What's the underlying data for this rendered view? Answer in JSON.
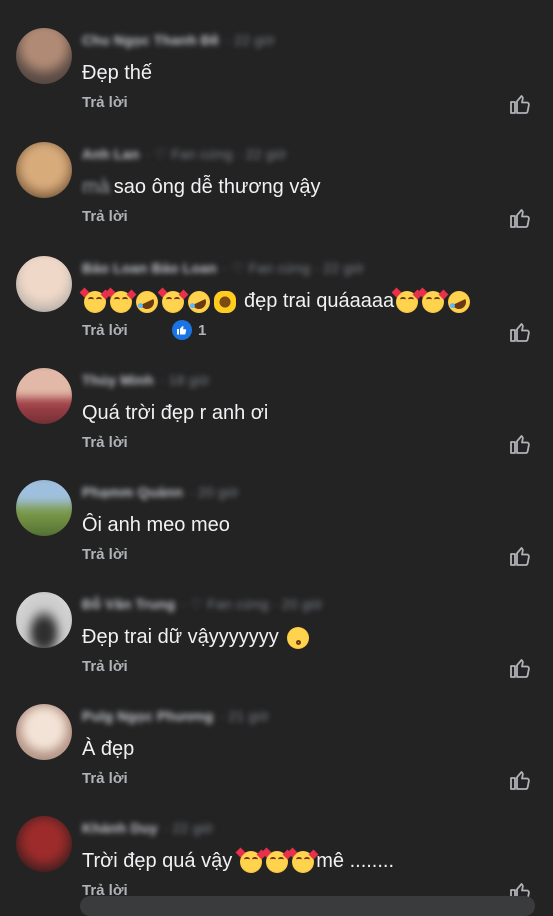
{
  "comments": [
    {
      "author": "Chu Ngọc Thanh Đề",
      "meta": "· 22 giờ",
      "text": "Đẹp thế",
      "reply": "Trả lời",
      "avatar": [
        "#5b4b45",
        "#b08a74"
      ]
    },
    {
      "author": "Anh Lan",
      "meta": "· ♡ Fan cứng · 22 giờ",
      "mention": "mà",
      "text": "sao ông dễ thương vậy",
      "reply": "Trả lời",
      "avatar": [
        "#7a5a3a",
        "#d8ab7b"
      ]
    },
    {
      "author": "Bảo Loan Bảo Loan",
      "meta": "· ♡ Fan cứng · 22 giờ",
      "text": "đẹp trai quáaaaa",
      "reply": "Trả lời",
      "reactions": "1",
      "avatar": [
        "#b9b1aa",
        "#f0d8c8"
      ]
    },
    {
      "author": "Thúy Minh",
      "meta": "· 18 giờ",
      "text": "Quá trời đẹp r anh ơi",
      "reply": "Trả lời",
      "avatar": [
        "#a4434a",
        "#e2b9a8"
      ]
    },
    {
      "author": "Phạmm Quảnn",
      "meta": "· 20 giờ",
      "text": "Ôi anh meo meo",
      "reply": "Trả lời",
      "avatar": [
        "#7aa0c0",
        "#4d6b2f"
      ]
    },
    {
      "author": "Đỗ Văn Trung",
      "meta": "· ♡ Fan cứng · 20 giờ",
      "text": "Đẹp trai dữ vậyyyyyyy",
      "reply": "Trả lời",
      "avatar": [
        "#c9c9c9",
        "#2f2f2f"
      ]
    },
    {
      "author": "Pulg Ngọc Phương",
      "meta": "· 21 giờ",
      "text": "À đẹp",
      "reply": "Trả lời",
      "avatar": [
        "#e6d5c9",
        "#b08f80"
      ]
    },
    {
      "author": "Khánh Duy",
      "meta": "· 22 giờ",
      "text": "Trời đẹp quá vậy",
      "suffix": "mê ........",
      "reply": "Trả lời",
      "avatar": [
        "#3a1d1d",
        "#9e2b2b"
      ]
    }
  ],
  "icons": {
    "like": "thumbs-up-outline-icon",
    "reaction": "like-reaction-icon"
  },
  "colors": {
    "background": "#232324",
    "reaction_blue": "#1b74e4",
    "text": "#f0f1f3",
    "muted": "#b0b3b8"
  }
}
